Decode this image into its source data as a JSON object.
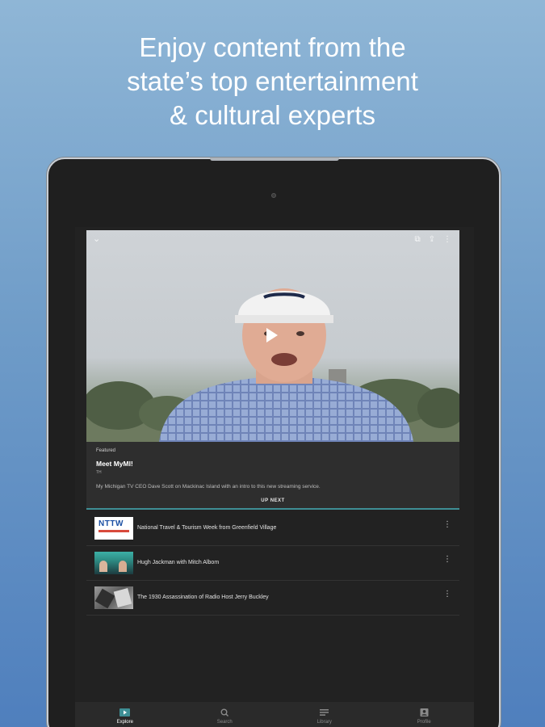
{
  "headline": {
    "line1": "Enjoy content from the",
    "line2": "state’s top entertainment",
    "line3": "& cultural experts"
  },
  "player": {
    "icons": [
      "collapse-icon",
      "cast-icon",
      "share-icon",
      "more-icon"
    ]
  },
  "featured": {
    "label": "Featured",
    "title": "Meet MyMI!",
    "sub": "TH",
    "description": "My Michigan TV CEO Dave Scott on Mackinac Island with an intro to this new streaming service.",
    "up_next": "UP NEXT"
  },
  "up_next_items": [
    {
      "title": "National Travel & Tourism Week from Greenfield Village",
      "thumb_text": "NTTW"
    },
    {
      "title": "Hugh Jackman with Mitch Albom"
    },
    {
      "title": "The 1930 Assassination of Radio Host Jerry Buckley"
    }
  ],
  "bottom_nav": [
    {
      "label": "Explore",
      "icon": "play-square-icon",
      "active": true
    },
    {
      "label": "Search",
      "icon": "search-icon",
      "active": false
    },
    {
      "label": "Library",
      "icon": "library-icon",
      "active": false
    },
    {
      "label": "Profile",
      "icon": "profile-icon",
      "active": false
    }
  ],
  "colors": {
    "accent": "#3e8f95",
    "background_top": "#8fb6d6",
    "background_bottom": "#4f7fbd"
  }
}
